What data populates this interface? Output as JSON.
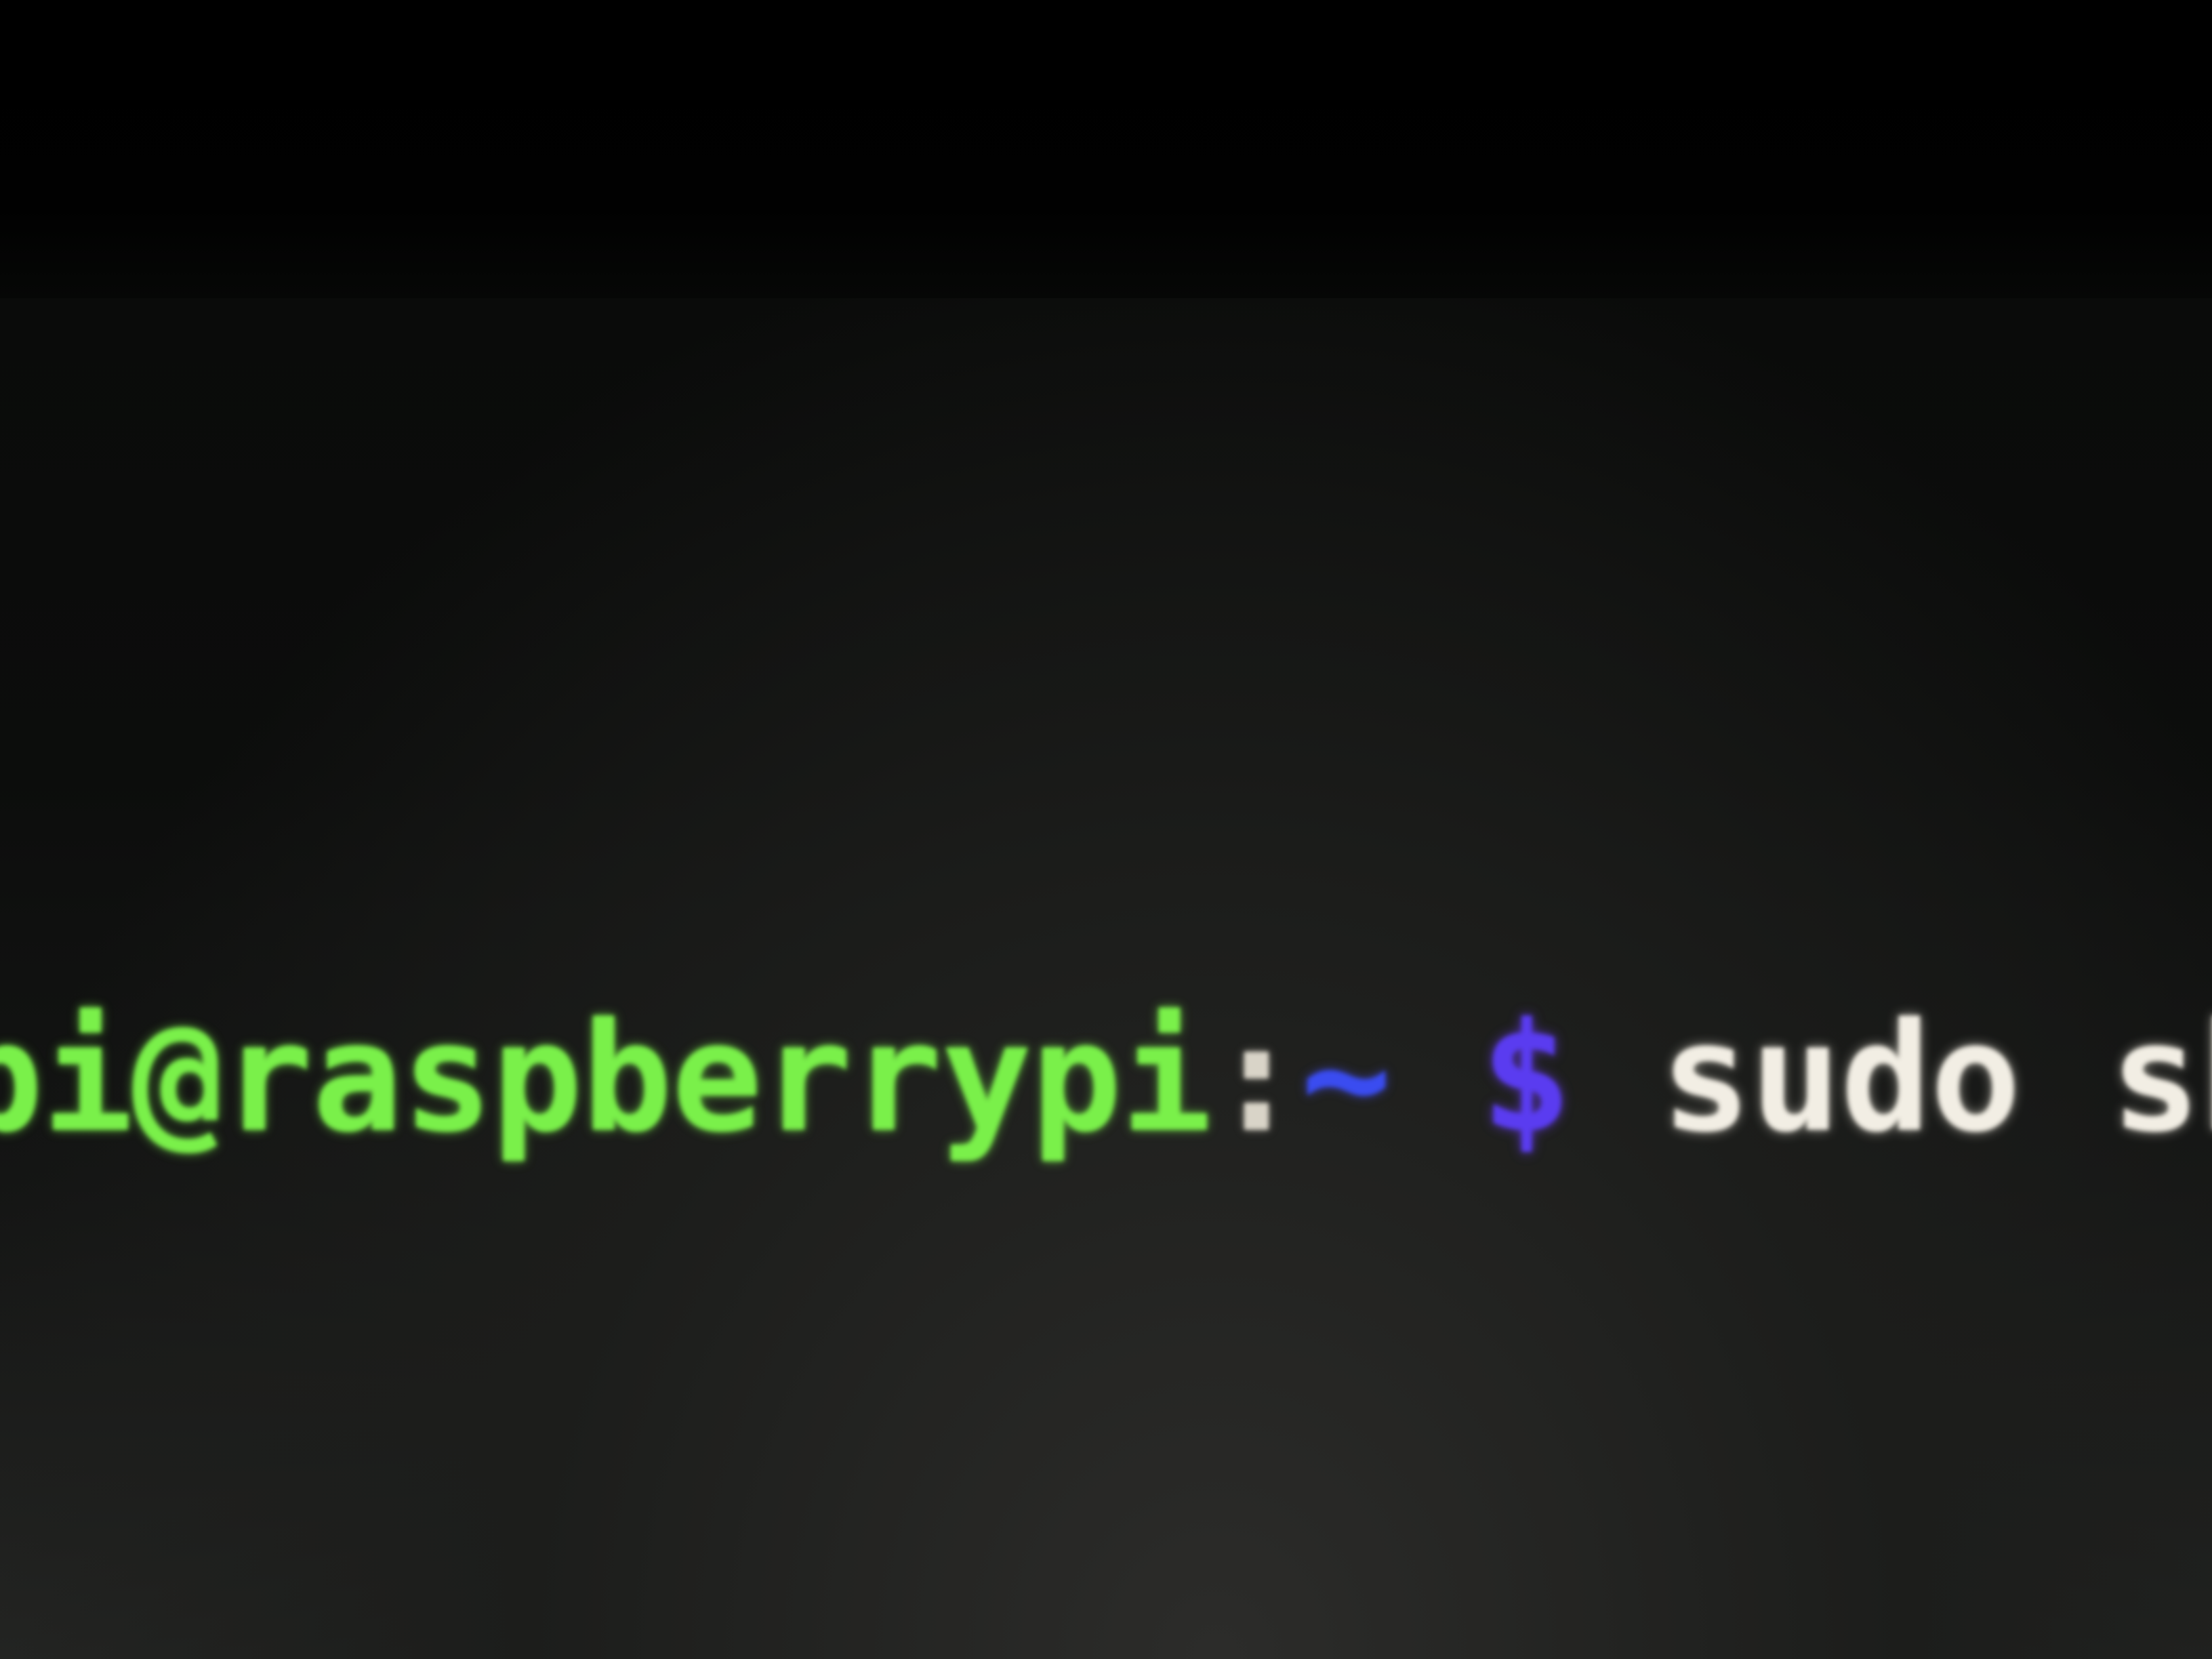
{
  "terminal": {
    "prompt": {
      "user_host": "pi@raspberrypi",
      "separator": ":",
      "path": "~",
      "symbol": "$"
    },
    "command": "sudo shutdown -r now"
  },
  "colors": {
    "user_host": "#7af04a",
    "path": "#3a4cf0",
    "prompt_symbol": "#5a3cf0",
    "command": "#f2eee4",
    "background": "#0c0d0c"
  }
}
